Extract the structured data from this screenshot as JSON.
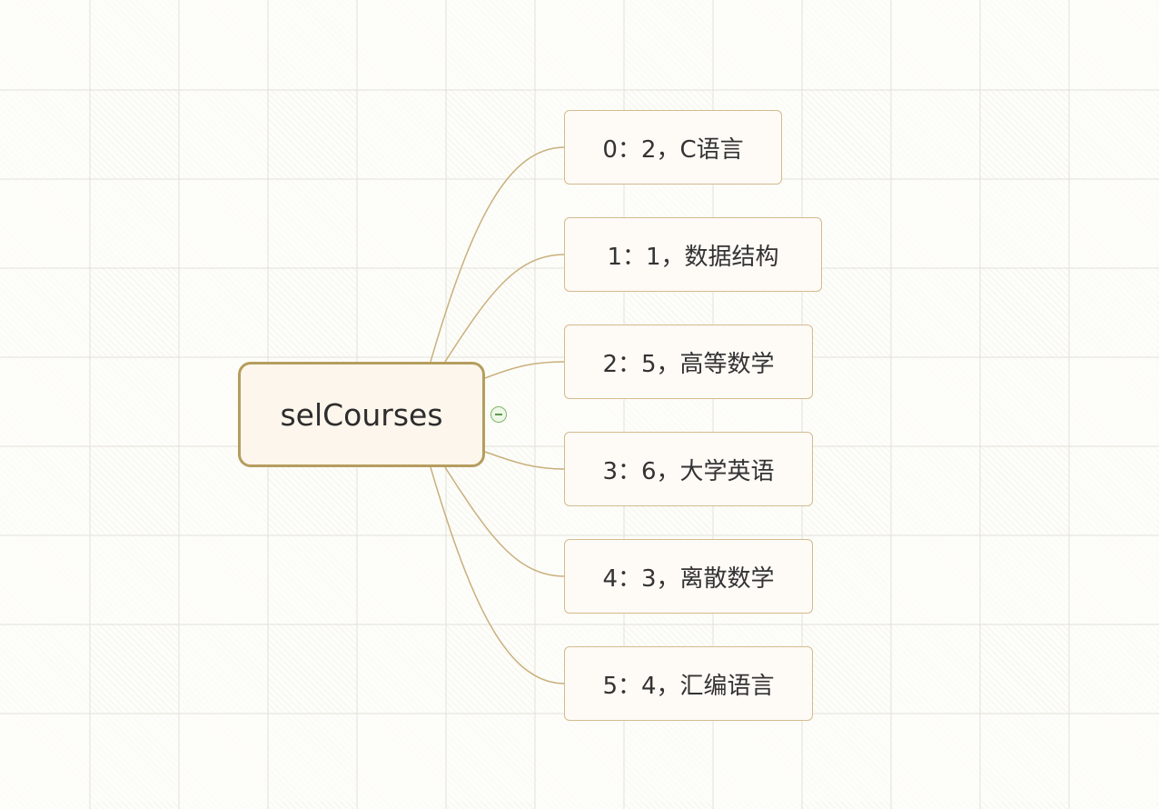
{
  "mindmap": {
    "central_topic": "selCourses",
    "collapse_toggle": "minus-circle-icon",
    "subtopics": [
      "0：2，C语言",
      "1：1，数据结构",
      "2：5，高等数学",
      "3：6，大学英语",
      "4：3，离散数学",
      "5：4，汇编语言"
    ]
  },
  "colors": {
    "background": "#fdfdfa",
    "central_border": "#b59d5e",
    "central_fill": "#fdf6ec",
    "subtopic_border": "#d4bb8c",
    "subtopic_fill": "#fefaf6",
    "connector": "#c9b07c",
    "toggle": "#7fb864"
  }
}
